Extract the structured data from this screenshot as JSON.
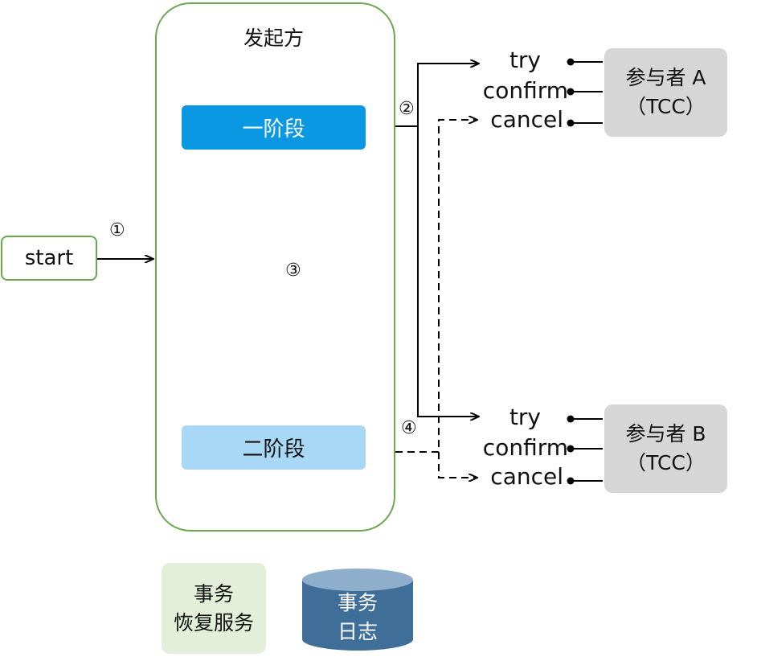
{
  "start": {
    "label": "start"
  },
  "initiator": {
    "title": "发起方"
  },
  "phase1": {
    "label": "一阶段"
  },
  "phase2": {
    "label": "二阶段"
  },
  "steps": {
    "s1": "①",
    "s2": "②",
    "s3": "③",
    "s4": "④"
  },
  "participant_a": {
    "line1": "参与者 A",
    "line2": "（TCC）",
    "try": "try",
    "confirm": "confirm",
    "cancel": "cancel"
  },
  "participant_b": {
    "line1": "参与者 B",
    "line2": "（TCC）",
    "try": "try",
    "confirm": "confirm",
    "cancel": "cancel"
  },
  "recovery_service": {
    "line1": "事务",
    "line2": "恢复服务"
  },
  "transaction_log": {
    "line1": "事务",
    "line2": "日志"
  },
  "colors": {
    "green_border": "#6aa84f",
    "phase1_fill": "#0a98e2",
    "phase2_fill": "#a9d8f6",
    "participant_fill": "#d6d6d6",
    "recovery_fill": "#e3efd8",
    "log_fill": "#3f6f98",
    "log_top": "#8eaecb"
  }
}
